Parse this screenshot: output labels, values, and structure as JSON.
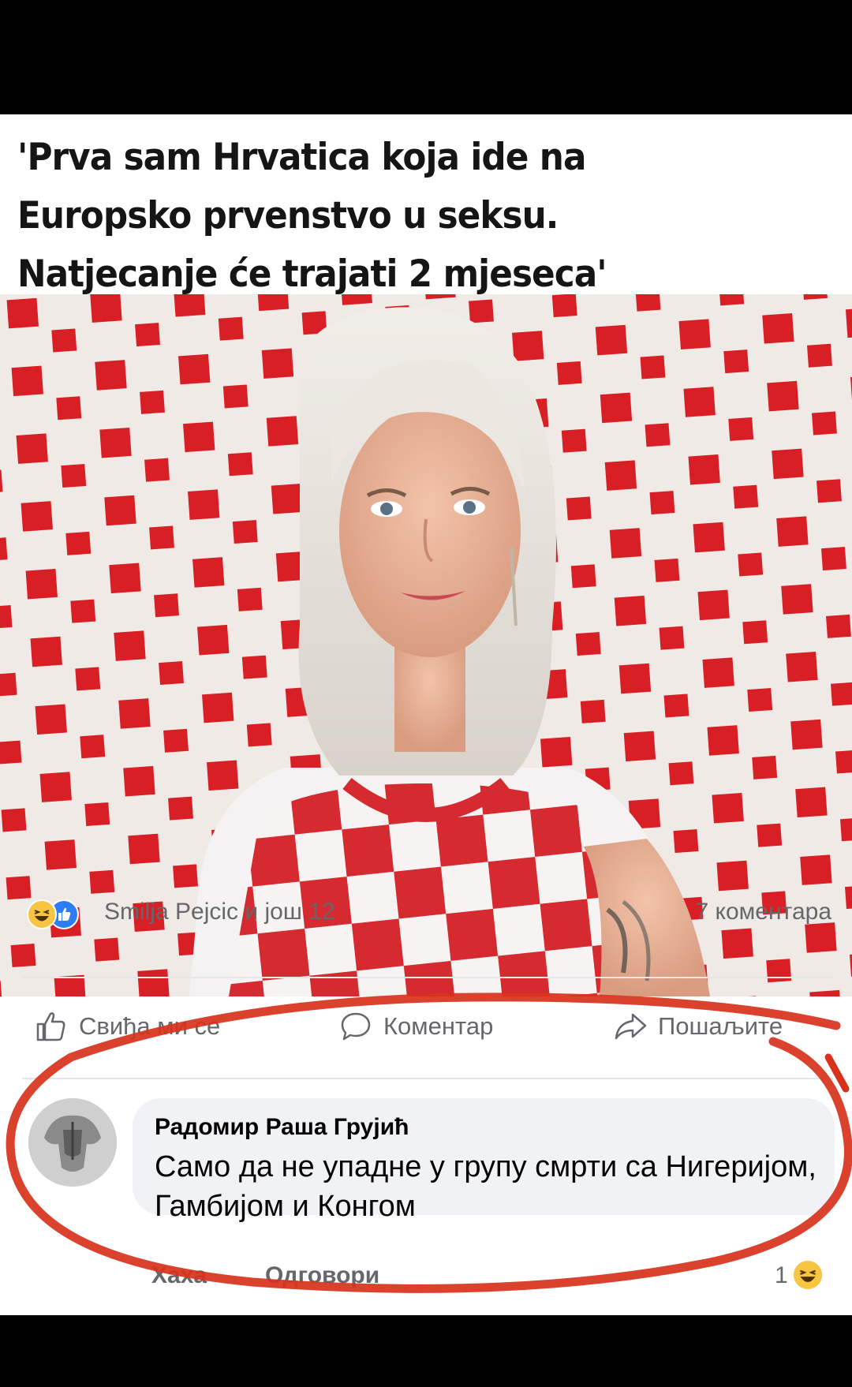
{
  "post": {
    "headline_lines": [
      "'Prva sam Hrvatica koja ide na",
      "Europsko prvenstvo u seksu.",
      "Natjecanje će trajati 2 mjeseca'"
    ]
  },
  "reactions": {
    "icons": [
      "haha-emoji-icon",
      "like-emoji-icon"
    ],
    "text": "Smilja Pejcic и још 12",
    "comments_count": "7 коментара"
  },
  "actions": {
    "like_label": "Свиђа ми се",
    "comment_label": "Коментар",
    "share_label": "Пошаљите"
  },
  "comment": {
    "author": "Радомир Раша Грујић",
    "text": "Само да не упадне у групу смрти са Нигеријом, Гамбијом и Конгом",
    "like_label": "Хаха",
    "reply_label": "Одговори",
    "reaction_count": "1"
  },
  "colors": {
    "annotation_red": "#d8321c",
    "checker_red": "#d81f26",
    "meta_gray": "#65676b",
    "bubble_bg": "#f0f2f5"
  }
}
